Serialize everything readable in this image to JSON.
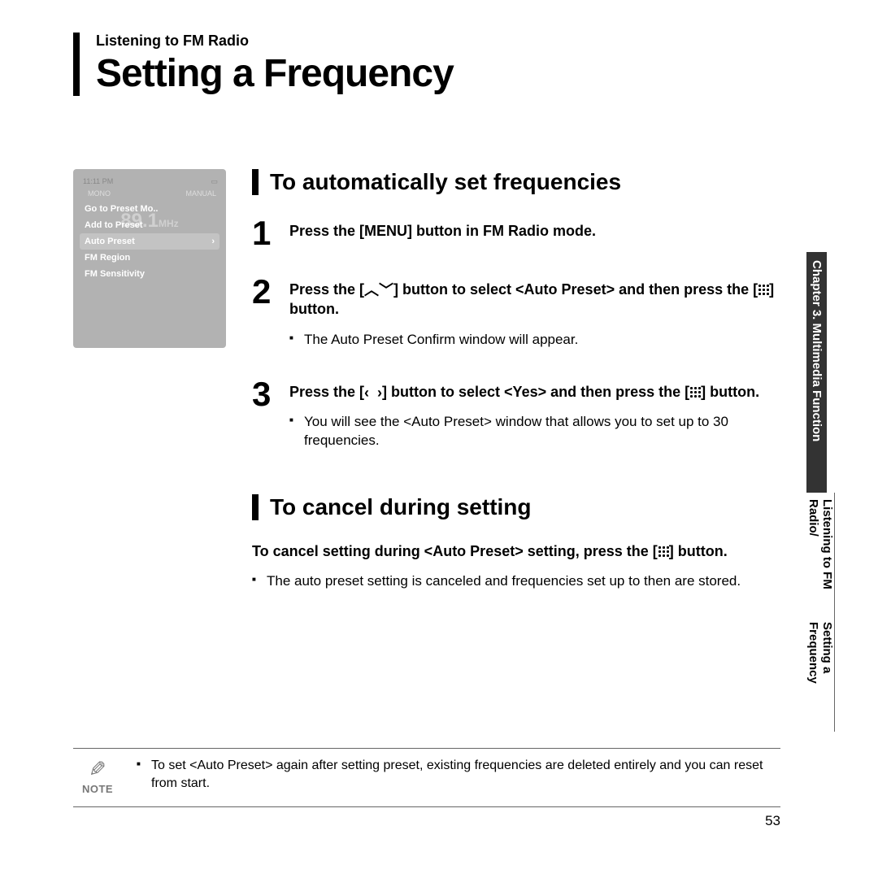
{
  "header": {
    "breadcrumb": "Listening to FM Radio",
    "title": "Setting a Frequency"
  },
  "device": {
    "status_time": "11:11 PM",
    "mode_left": "MONO",
    "mode_right": "MANUAL",
    "freq_value": "89.1",
    "freq_unit": "MHz",
    "menu": {
      "item0": "Go to Preset Mo..",
      "item1": "Add to Preset",
      "item2": "Auto Preset",
      "item2_arrow": "›",
      "item3": "FM Region",
      "item4": "FM Sensitivity"
    }
  },
  "section1": {
    "heading": "To automatically set frequencies",
    "step1": {
      "num": "1",
      "text": "Press the [MENU] button in FM Radio mode."
    },
    "step2": {
      "num": "2",
      "pre": "Press the [",
      "mid": "] button to select <Auto Preset> and then press the [",
      "post": "] button.",
      "sub1": "The Auto Preset Confirm window will appear."
    },
    "step3": {
      "num": "3",
      "pre": "Press the [",
      "mid": "] button to select <Yes> and then press the [",
      "post": "] button.",
      "sub1": "You will see the <Auto Preset> window that allows you to set up to 30 frequencies."
    }
  },
  "section2": {
    "heading": "To cancel during setting",
    "instr_pre": "To cancel setting during <Auto Preset> setting, press the [",
    "instr_post": "] button.",
    "sub1": "The auto preset setting is canceled and frequencies set up to then are stored."
  },
  "note": {
    "label": "NOTE",
    "text": "To set <Auto Preset> again after setting preset, existing frequencies are deleted entirely and you can reset from start."
  },
  "sidetab": {
    "chapter": "Chapter 3. Multimedia Function",
    "line1": "Listening to FM Radio/",
    "line2": "Setting a Frequency"
  },
  "pagenum": "53"
}
